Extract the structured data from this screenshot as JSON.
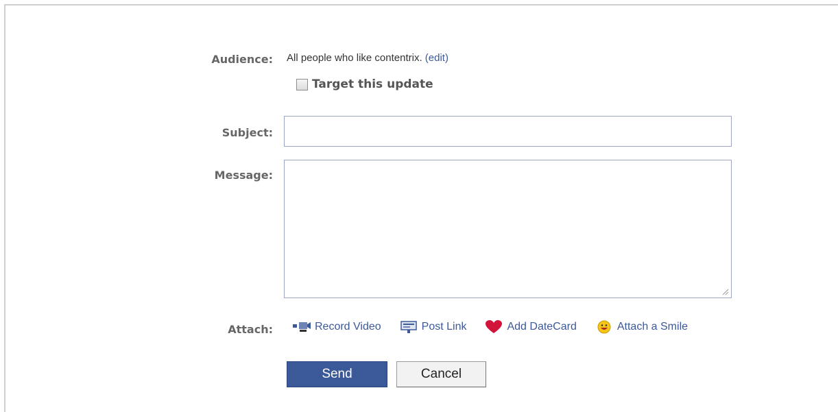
{
  "form": {
    "audience_label": "Audience:",
    "audience_text": "All people who like contentrix.",
    "audience_edit_link": "(edit)",
    "target_checkbox_label": "Target this update",
    "target_checked": false,
    "subject_label": "Subject:",
    "subject_value": "",
    "message_label": "Message:",
    "message_value": "",
    "attach_label": "Attach:"
  },
  "attachments": [
    {
      "label": "Record Video",
      "icon": "video-camera-icon"
    },
    {
      "label": "Post Link",
      "icon": "link-icon"
    },
    {
      "label": "Add DateCard",
      "icon": "heart-icon"
    },
    {
      "label": "Attach a Smile",
      "icon": "smiley-icon"
    }
  ],
  "buttons": {
    "send_label": "Send",
    "cancel_label": "Cancel"
  },
  "colors": {
    "link": "#3b5998",
    "send_bg": "#3b5998",
    "heart": "#d2143a",
    "smiley": "#f5c518"
  }
}
